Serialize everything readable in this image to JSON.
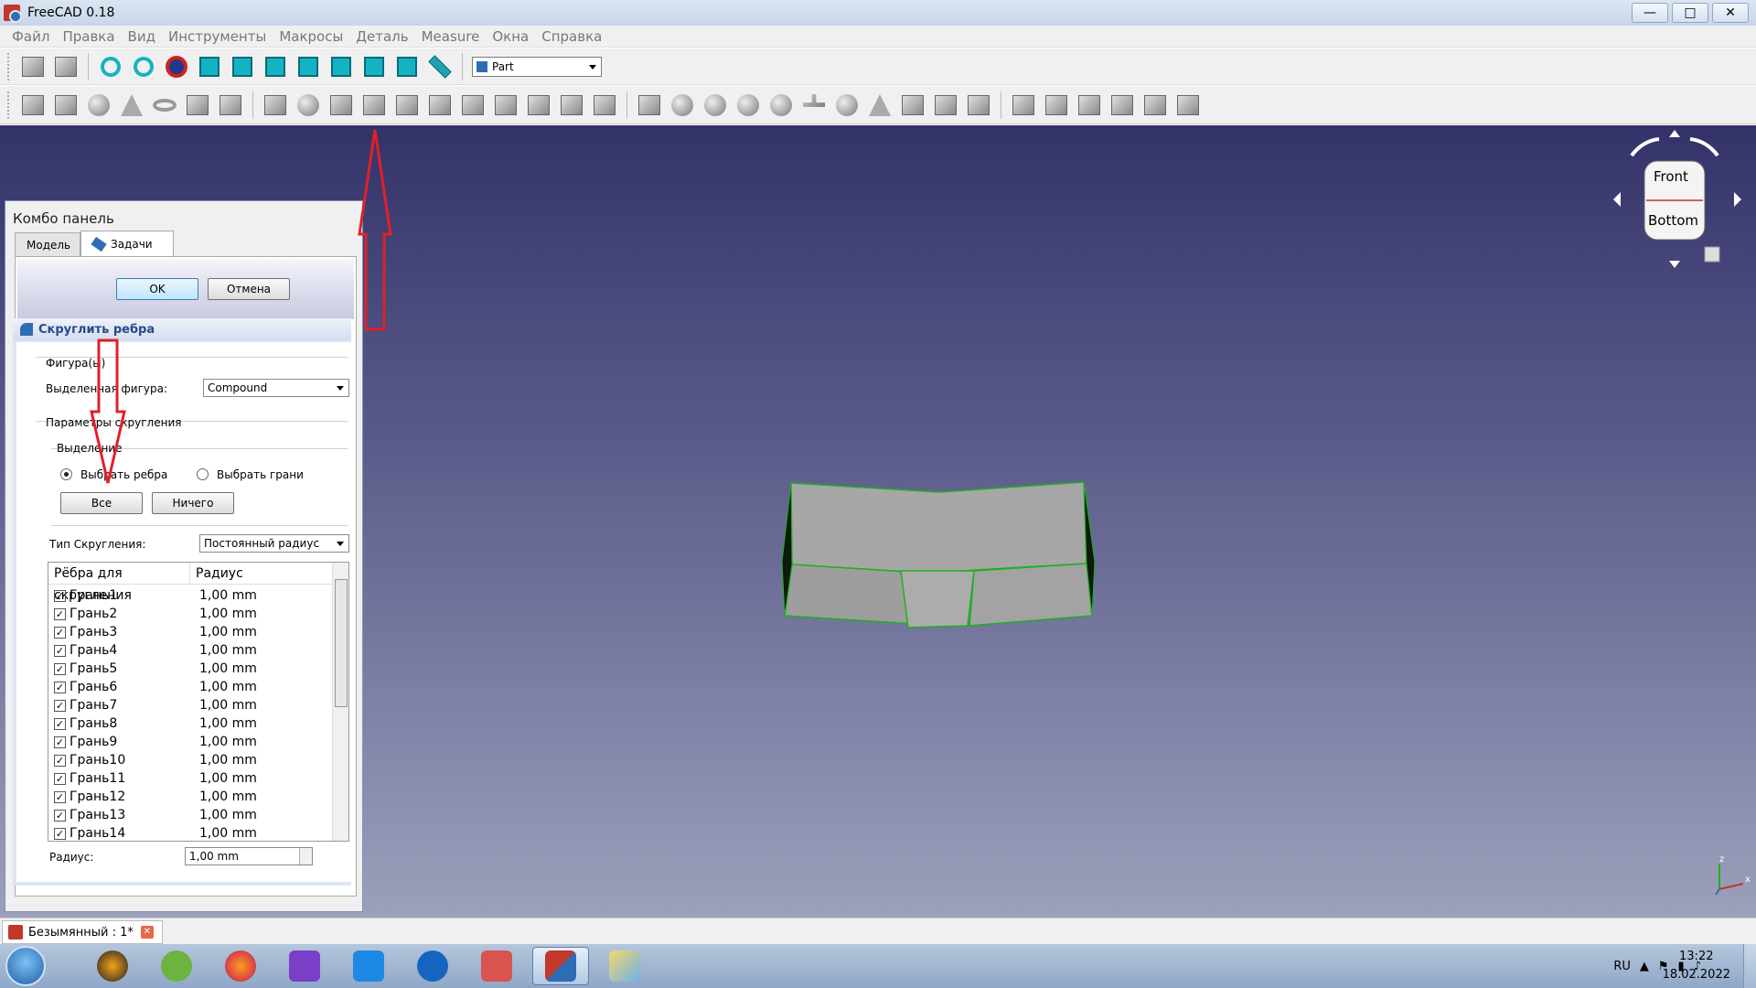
{
  "window": {
    "title": "FreeCAD 0.18",
    "min_label": "—",
    "max_label": "□",
    "close_label": "✕"
  },
  "menu": [
    "Файл",
    "Правка",
    "Вид",
    "Инструменты",
    "Макросы",
    "Деталь",
    "Measure",
    "Окна",
    "Справка"
  ],
  "workbench": {
    "selected": "Part"
  },
  "combo": {
    "title": "Комбо панель",
    "tabs": {
      "model": "Модель",
      "tasks": "Задачи"
    },
    "ok_label": "OK",
    "cancel_label": "Отмена",
    "section_title": "Скруглить ребра",
    "shape_group": "Фигура(ы)",
    "selected_shape_label": "Выделенная фигура:",
    "selected_shape_value": "Compound",
    "params_group": "Параметры скругления",
    "selection_group": "Выделение",
    "radio_edges": "Выбрать ребра",
    "radio_faces": "Выбрать грани",
    "all_button": "Все",
    "none_button": "Ничего",
    "fillet_type_label": "Тип Скругления:",
    "fillet_type_value": "Постоянный радиус",
    "table_headers": {
      "edges": "Рёбра для скругления",
      "radius": "Радиус"
    },
    "rows": [
      {
        "name": "Грань1",
        "radius": "1,00 mm"
      },
      {
        "name": "Грань2",
        "radius": "1,00 mm"
      },
      {
        "name": "Грань3",
        "radius": "1,00 mm"
      },
      {
        "name": "Грань4",
        "radius": "1,00 mm"
      },
      {
        "name": "Грань5",
        "radius": "1,00 mm"
      },
      {
        "name": "Грань6",
        "radius": "1,00 mm"
      },
      {
        "name": "Грань7",
        "radius": "1,00 mm"
      },
      {
        "name": "Грань8",
        "radius": "1,00 mm"
      },
      {
        "name": "Грань9",
        "radius": "1,00 mm"
      },
      {
        "name": "Грань10",
        "radius": "1,00 mm"
      },
      {
        "name": "Грань11",
        "radius": "1,00 mm"
      },
      {
        "name": "Грань12",
        "radius": "1,00 mm"
      },
      {
        "name": "Грань13",
        "radius": "1,00 mm"
      },
      {
        "name": "Грань14",
        "radius": "1,00 mm"
      }
    ],
    "radius_label": "Радиус:",
    "radius_value": "1,00 mm",
    "check_mark": "✓"
  },
  "navcube": {
    "front": "Front",
    "bottom": "Bottom"
  },
  "axis": {
    "x": "x",
    "z": "z"
  },
  "document_tab": {
    "label": "Безымянный : 1*",
    "close": "✕"
  },
  "taskbar": {
    "lang": "RU",
    "time": "13:22",
    "date": "18.02.2022"
  },
  "colors": {
    "viewport_top": "#33336a",
    "viewport_bottom": "#9ca0bb",
    "annotation_arrow": "#e0202a",
    "edge_highlight": "#1fb01f",
    "part_face": "#a9a9a9"
  }
}
